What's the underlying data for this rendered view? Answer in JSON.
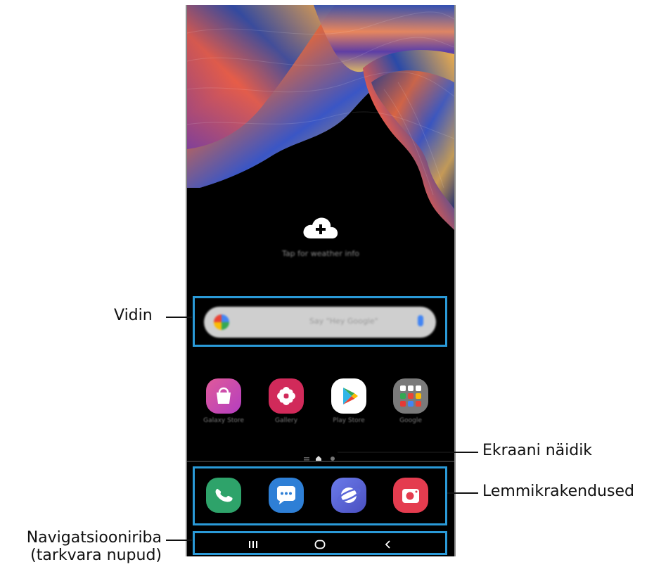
{
  "callouts": {
    "widget": "Vidin",
    "page_indicator": "Ekraani näidik",
    "favorite_apps": "Lemmikrakendused",
    "navbar_line1": "Navigatsiooniriba",
    "navbar_line2": "(tarkvara nupud)"
  },
  "screen": {
    "weather_text": "Tap for weather info",
    "search_hint": "Say \"Hey Google\"",
    "apps": [
      {
        "label": "Galaxy Store",
        "icon": "shopping-bag-icon",
        "color": "#c2419f"
      },
      {
        "label": "Gallery",
        "icon": "flower-icon",
        "color": "#d12a5a"
      },
      {
        "label": "Play Store",
        "icon": "play-triangle-icon",
        "color": "#ffffff"
      },
      {
        "label": "Google",
        "icon": "folder-grid-icon",
        "color": "#7a7a7a"
      }
    ],
    "dock": [
      {
        "name": "phone",
        "icon": "phone-icon",
        "color": "#2ea36a"
      },
      {
        "name": "messages",
        "icon": "chat-bubble-icon",
        "color": "#2e7fd6"
      },
      {
        "name": "internet",
        "icon": "planet-icon",
        "color": "#5a67d8"
      },
      {
        "name": "camera",
        "icon": "camera-icon",
        "color": "#e43c4f"
      }
    ],
    "nav": {
      "recents_icon": "recents-icon",
      "home_icon": "home-icon",
      "back_icon": "back-icon"
    }
  },
  "colors": {
    "highlight": "#2a9ad8",
    "screen_bg": "#000000"
  }
}
